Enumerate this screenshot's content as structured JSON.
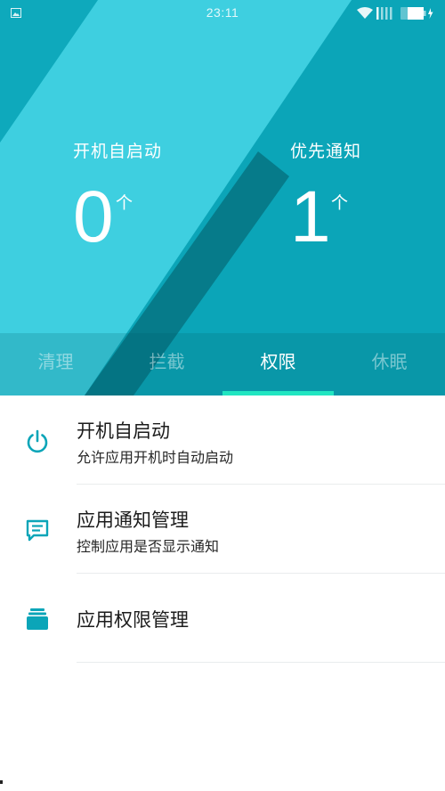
{
  "status_bar": {
    "time": "23:11",
    "icons": [
      "image-icon",
      "wifi-icon",
      "signal-icon",
      "battery-icon"
    ]
  },
  "colors": {
    "hero_base": "#0ba5b8",
    "hero_light_band": "#3ecfe0",
    "hero_dark_band": "#067b8a",
    "tab_indicator": "#21e6c1",
    "list_icon": "#0ba5b8"
  },
  "stats": {
    "autostart": {
      "label": "开机自启动",
      "value": "0",
      "unit": "个"
    },
    "notify": {
      "label": "优先通知",
      "value": "1",
      "unit": "个"
    }
  },
  "tabs": [
    {
      "label": "清理",
      "active": false
    },
    {
      "label": "拦截",
      "active": false
    },
    {
      "label": "权限",
      "active": true
    },
    {
      "label": "休眠",
      "active": false
    }
  ],
  "list": [
    {
      "icon": "power-icon",
      "title": "开机自启动",
      "subtitle": "允许应用开机时自动启动"
    },
    {
      "icon": "message-icon",
      "title": "应用通知管理",
      "subtitle": "控制应用是否显示通知"
    },
    {
      "icon": "folder-stack-icon",
      "title": "应用权限管理",
      "subtitle": ""
    }
  ]
}
